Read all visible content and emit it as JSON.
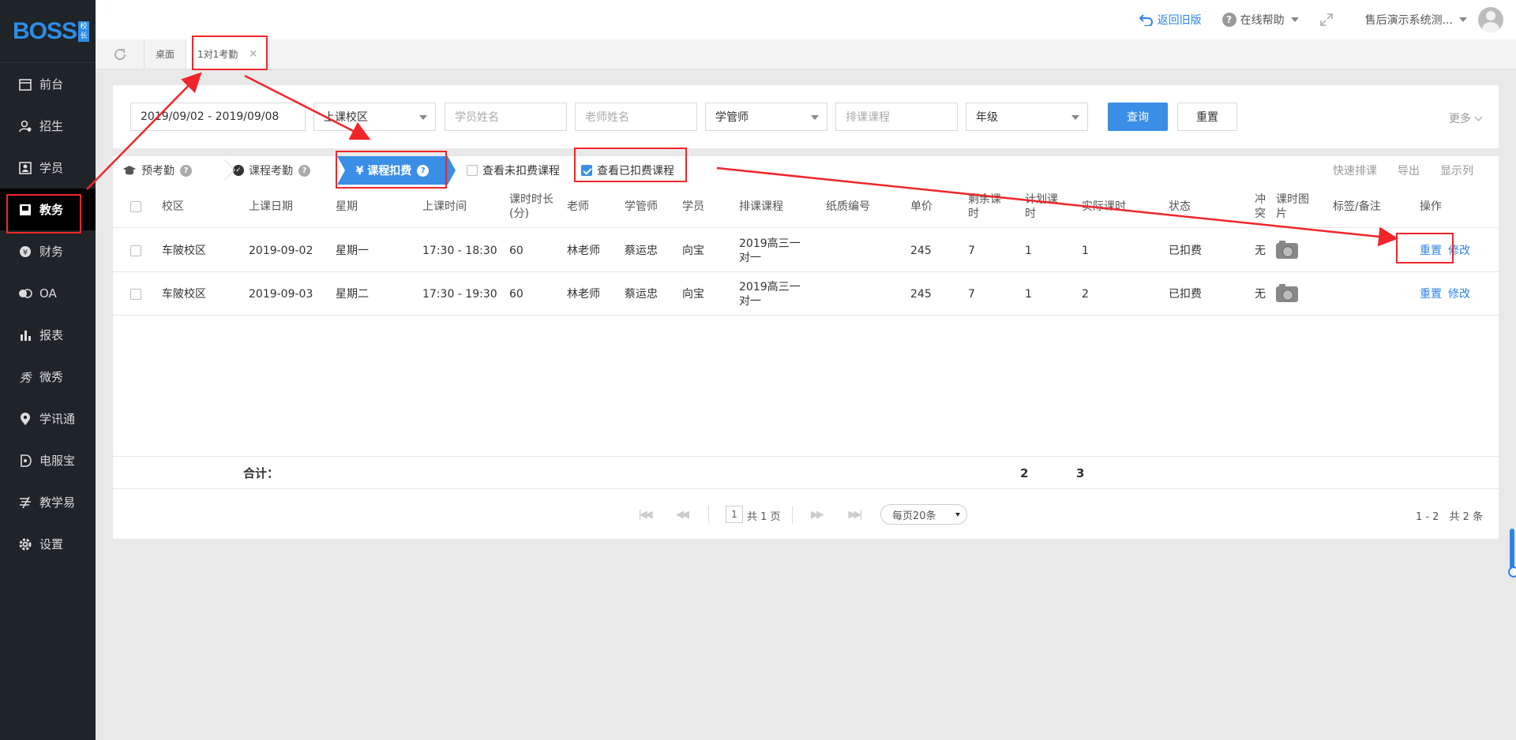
{
  "brand": {
    "logo_text": "BOSS",
    "logo_tag": "校长"
  },
  "sidebar": {
    "items": [
      {
        "label": "前台",
        "icon": "calendar-icon"
      },
      {
        "label": "招生",
        "icon": "recruit-icon"
      },
      {
        "label": "学员",
        "icon": "student-card-icon"
      },
      {
        "label": "教务",
        "icon": "book-icon",
        "active": true
      },
      {
        "label": "财务",
        "icon": "yen-icon"
      },
      {
        "label": "OA",
        "icon": "oa-icon"
      },
      {
        "label": "报表",
        "icon": "bar-chart-icon"
      },
      {
        "label": "微秀",
        "icon": "xiu-icon"
      },
      {
        "label": "学讯通",
        "icon": "location-icon"
      },
      {
        "label": "电服宝",
        "icon": "phone-service-icon"
      },
      {
        "label": "教学易",
        "icon": "teach-icon"
      },
      {
        "label": "设置",
        "icon": "gear-icon"
      }
    ]
  },
  "topbar": {
    "back_old": "返回旧版",
    "help": "在线帮助",
    "user": "售后演示系统测..."
  },
  "tabs": [
    {
      "label": "桌面"
    },
    {
      "label": "1对1考勤",
      "active": true,
      "close": "×"
    }
  ],
  "filters": {
    "date_range": "2019/09/02 - 2019/09/08",
    "campus": "上课校区",
    "student_placeholder": "学员姓名",
    "teacher_placeholder": "老师姓名",
    "manager": "学管师",
    "course_placeholder": "排课课程",
    "grade": "年级",
    "query": "查询",
    "reset": "重置",
    "more": "更多"
  },
  "toolbar": {
    "step1": "预考勤",
    "step2": "课程考勤",
    "step3": "¥ 课程扣费",
    "opt_uncharged": "查看未扣费课程",
    "opt_charged": "查看已扣费课程",
    "quick_schedule": "快速排课",
    "export": "导出",
    "columns": "显示列"
  },
  "table": {
    "headers": [
      "校区",
      "上课日期",
      "星期",
      "上课时间",
      "课时时长(分)",
      "老师",
      "学管师",
      "学员",
      "排课课程",
      "纸质编号",
      "单价",
      "剩余课时",
      "计划课时",
      "实际课时",
      "状态",
      "冲突",
      "课时图片",
      "标签/备注",
      "操作"
    ],
    "header_lines": {
      "duration": [
        "课时时长",
        "(分)"
      ],
      "remaining": [
        "剩余课",
        "时"
      ],
      "planned": [
        "计划课",
        "时"
      ],
      "conflict": [
        "冲",
        "突"
      ],
      "photo": [
        "课时图",
        "片"
      ]
    },
    "rows": [
      {
        "campus": "车陂校区",
        "date": "2019-09-02",
        "weekday": "星期一",
        "time": "17:30 - 18:30",
        "duration": "60",
        "teacher": "林老师",
        "manager": "蔡运忠",
        "student": "向宝",
        "course1": "2019高三一",
        "course2": "对一",
        "paper_no": "",
        "price": "245",
        "remaining": "7",
        "planned": "1",
        "actual": "1",
        "status": "已扣费",
        "conflict": "无",
        "op_reset": "重置",
        "op_edit": "修改"
      },
      {
        "campus": "车陂校区",
        "date": "2019-09-03",
        "weekday": "星期二",
        "time": "17:30 - 19:30",
        "duration": "60",
        "teacher": "林老师",
        "manager": "蔡运忠",
        "student": "向宝",
        "course1": "2019高三一",
        "course2": "对一",
        "paper_no": "",
        "price": "245",
        "remaining": "7",
        "planned": "1",
        "actual": "2",
        "status": "已扣费",
        "conflict": "无",
        "op_reset": "重置",
        "op_edit": "修改"
      }
    ],
    "total_label": "合计：",
    "total_planned": "2",
    "total_actual": "3"
  },
  "pager": {
    "page": "1",
    "total_pages": "共 1 页",
    "page_size": "每页20条",
    "summary": "1 - 2　共 2 条"
  }
}
